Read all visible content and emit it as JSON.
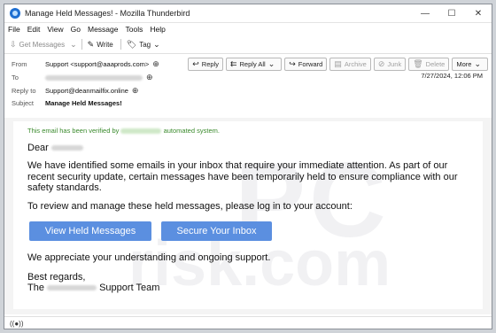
{
  "window": {
    "title": "Manage Held Messages! - Mozilla Thunderbird",
    "min": "—",
    "max": "☐",
    "close": "✕"
  },
  "menu": [
    "File",
    "Edit",
    "View",
    "Go",
    "Message",
    "Tools",
    "Help"
  ],
  "toolbar": {
    "get_messages": "Get Messages",
    "write": "Write",
    "tag": "Tag"
  },
  "header": {
    "from_label": "From",
    "from_value": "Support <support@aaaprods.com>",
    "to_label": "To",
    "reply_to_label": "Reply to",
    "reply_to_value": "Support@deanmailfix.online",
    "subject_label": "Subject",
    "subject_value": "Manage Held Messages!",
    "date": "7/27/2024, 12:06 PM",
    "buttons": {
      "reply": "Reply",
      "reply_all": "Reply All",
      "forward": "Forward",
      "archive": "Archive",
      "junk": "Junk",
      "delete": "Delete",
      "more": "More"
    }
  },
  "email": {
    "verified_pre": "This email has been verified by",
    "verified_post": "automated system.",
    "greeting": "Dear",
    "para1": "We have identified some emails in your inbox that require your immediate attention. As part of our recent security update, certain messages have been temporarily held to ensure compliance with our safety standards.",
    "para2": "To review and manage these held messages, please log in to your account:",
    "btn1": "View Held Messages",
    "btn2": "Secure Your Inbox",
    "para3": "We appreciate your understanding and ongoing support.",
    "regards": "Best regards,",
    "team_pre": "The",
    "team_post": "Support Team"
  },
  "status": "((●))",
  "colors": {
    "accent": "#5b8fe0",
    "verified": "#3a8a2c"
  }
}
